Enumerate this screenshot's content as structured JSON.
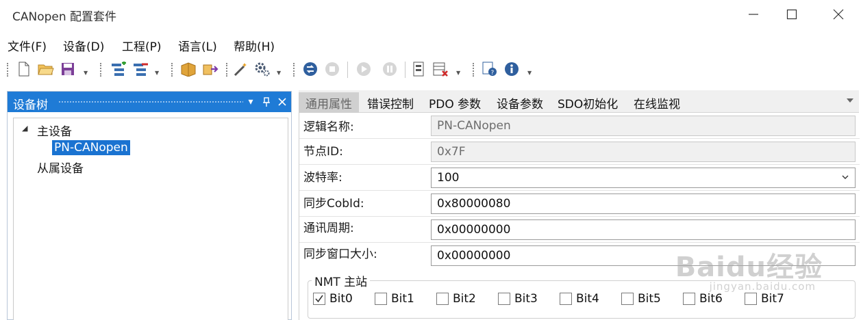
{
  "window": {
    "title": "CANopen 配置套件"
  },
  "menu": [
    {
      "label": "文件(F)"
    },
    {
      "label": "设备(D)"
    },
    {
      "label": "工程(P)"
    },
    {
      "label": "语言(L)"
    },
    {
      "label": "帮助(H)"
    }
  ],
  "toolbar": {
    "icons": [
      "new-file-icon",
      "open-folder-icon",
      "save-icon",
      "add-device-icon",
      "remove-device-icon",
      "import-icon",
      "export-icon",
      "wizard-icon",
      "settings-gear-icon",
      "connect-icon",
      "stop-icon",
      "play-icon",
      "pause-icon",
      "device-list-icon",
      "delete-config-icon",
      "help-doc-icon",
      "info-icon"
    ]
  },
  "device_tree": {
    "title": "设备树",
    "master_label": "主设备",
    "master_child": "PN-CANopen",
    "slave_label": "从属设备"
  },
  "tabs": [
    {
      "label": "通用属性",
      "active": true
    },
    {
      "label": "错误控制"
    },
    {
      "label": "PDO 参数"
    },
    {
      "label": "设备参数"
    },
    {
      "label": "SDO初始化"
    },
    {
      "label": "在线监视"
    }
  ],
  "properties": {
    "logical_name": {
      "label": "逻辑名称:",
      "value": "PN-CANopen"
    },
    "node_id": {
      "label": "节点ID:",
      "value": "0x7F"
    },
    "baud_rate": {
      "label": "波特率:",
      "value": "100"
    },
    "sync_cobid": {
      "label": "同步CobId:",
      "value": "0x80000080"
    },
    "comm_cycle": {
      "label": "通讯周期:",
      "value": "0x00000000"
    },
    "sync_window": {
      "label": "同步窗口大小:",
      "value": "0x00000000"
    }
  },
  "nmt_master": {
    "title": "NMT 主站",
    "bits": [
      {
        "label": "Bit0",
        "checked": true
      },
      {
        "label": "Bit1",
        "checked": false
      },
      {
        "label": "Bit2",
        "checked": false
      },
      {
        "label": "Bit3",
        "checked": false
      },
      {
        "label": "Bit4",
        "checked": false
      },
      {
        "label": "Bit5",
        "checked": false
      },
      {
        "label": "Bit6",
        "checked": false
      },
      {
        "label": "Bit7",
        "checked": false
      }
    ]
  },
  "watermark": {
    "main": "Baidu经验",
    "sub": "jingyan.baidu.com"
  }
}
